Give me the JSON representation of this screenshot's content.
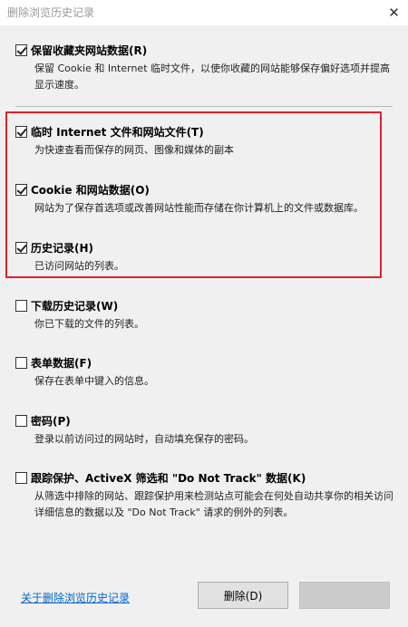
{
  "window": {
    "title": "删除浏览历史记录",
    "close_glyph": "✕"
  },
  "options": [
    {
      "checked": true,
      "label": "保留收藏夹网站数据(R)",
      "description": "保留 Cookie 和 Internet 临时文件，以使你收藏的网站能够保存偏好选项并提高显示速度。"
    },
    {
      "checked": true,
      "label": "临时 Internet 文件和网站文件(T)",
      "description": "为快速查看而保存的网页、图像和媒体的副本"
    },
    {
      "checked": true,
      "label": "Cookie 和网站数据(O)",
      "description": "网站为了保存首选项或改善网站性能而存储在你计算机上的文件或数据库。"
    },
    {
      "checked": true,
      "label": "历史记录(H)",
      "description": "已访问网站的列表。"
    },
    {
      "checked": false,
      "label": "下载历史记录(W)",
      "description": "你已下载的文件的列表。"
    },
    {
      "checked": false,
      "label": "表单数据(F)",
      "description": "保存在表单中键入的信息。"
    },
    {
      "checked": false,
      "label": "密码(P)",
      "description": "登录以前访问过的网站时，自动填充保存的密码。"
    },
    {
      "checked": false,
      "label": "跟踪保护、ActiveX 筛选和 \"Do Not Track\" 数据(K)",
      "description": "从筛选中排除的网站、跟踪保护用来检测站点可能会在何处自动共享你的相关访问详细信息的数据以及 \"Do Not Track\" 请求的例外的列表。"
    }
  ],
  "footer": {
    "about_link": "关于删除浏览历史记录",
    "delete_button": "删除(D)",
    "cancel_button": ""
  },
  "colors": {
    "highlight_border": "#e0202a",
    "link": "#0066cc",
    "dialog_bg": "#f0f0f0"
  }
}
